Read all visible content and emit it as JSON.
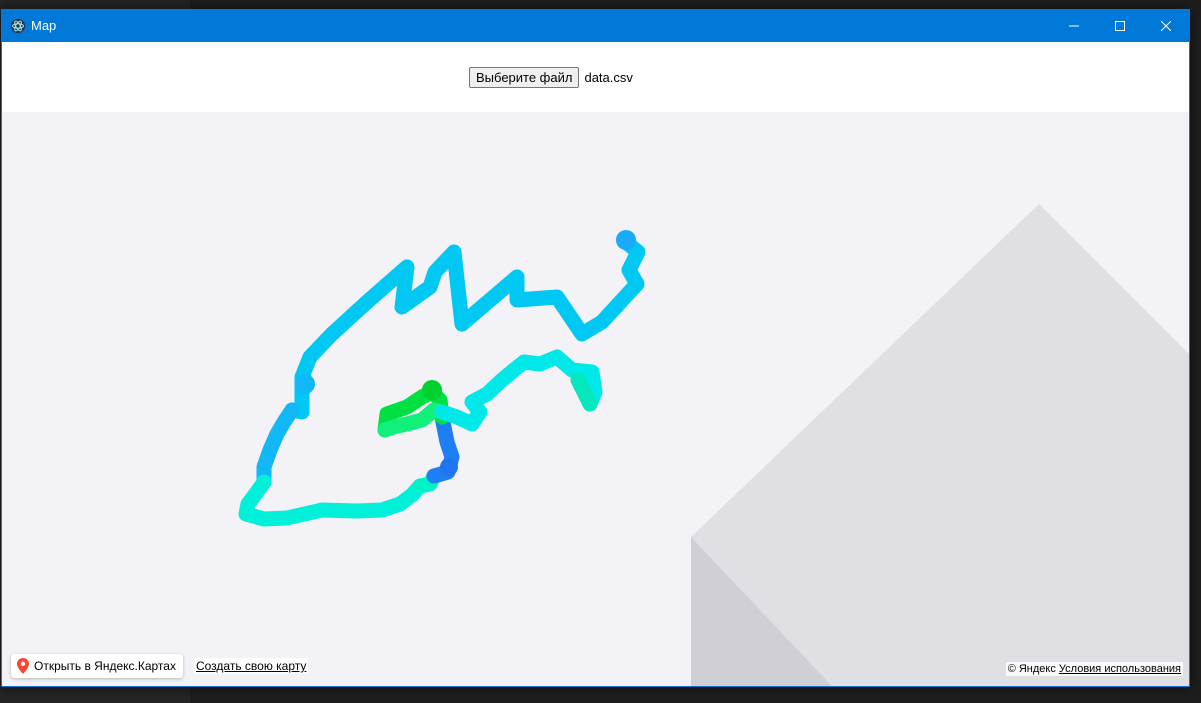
{
  "window": {
    "title": "Map",
    "controls": {
      "minimize": "minimize-icon",
      "maximize": "maximize-icon",
      "close": "close-icon"
    }
  },
  "toolbar": {
    "file_button_label": "Выберите файл",
    "file_name": "data.csv"
  },
  "map": {
    "open_in_maps_label": "Открыть в Яндекс.Картах",
    "create_map_label": "Создать свою карту",
    "copyright_label": "© Яндекс",
    "terms_label": "Условия использования",
    "colors": {
      "titlebar": "#0078d7",
      "map_bg": "#f2f2f7",
      "route_main": "#00c8f0",
      "route_green": "#00e040",
      "route_blue": "#1e90ff",
      "route_teal": "#00f0d0"
    }
  }
}
